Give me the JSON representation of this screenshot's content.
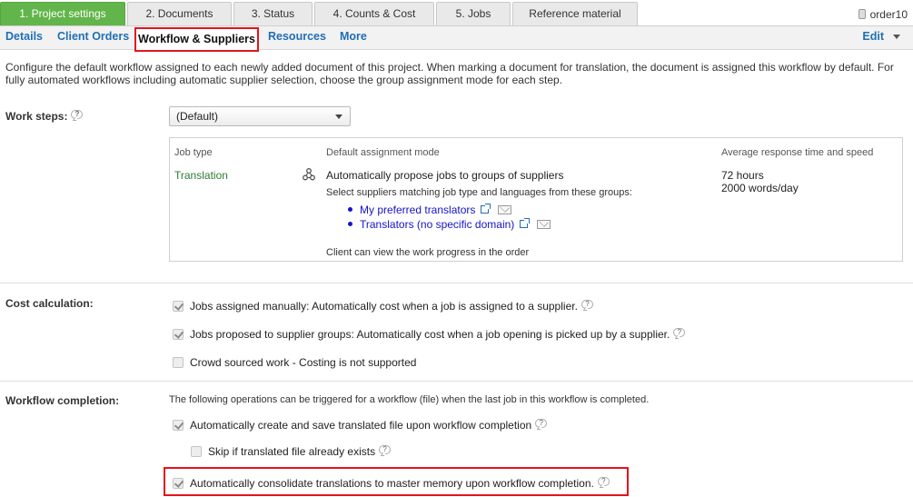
{
  "steps": [
    "1. Project settings",
    "2. Documents",
    "3. Status",
    "4. Counts & Cost",
    "5. Jobs",
    "Reference material"
  ],
  "order_label": "order10",
  "subnav": {
    "details": "Details",
    "client_orders": "Client Orders",
    "workflow": "Workflow & Suppliers",
    "resources": "Resources",
    "more": "More",
    "edit": "Edit"
  },
  "intro": "Configure the default workflow assigned to each newly added document of this project. When marking a document for translation, the document is assigned this workflow by default. For fully automated workflows including automatic supplier selection, choose the group assignment mode for each step.",
  "work_steps": {
    "label": "Work steps:",
    "help": "?",
    "selected": "(Default)",
    "table": {
      "headers": [
        "Job type",
        "Default assignment mode",
        "Average response time and speed"
      ],
      "job_type": "Translation",
      "mode": "Automatically propose jobs to groups of suppliers",
      "sub": "Select suppliers matching job type and languages from these groups:",
      "groups": [
        "My preferred translators",
        "Translators (no specific domain)"
      ],
      "client_note": "Client can view the work progress in the order",
      "response_time": "72 hours",
      "speed": "2000 words/day"
    }
  },
  "cost": {
    "label": "Cost calculation:",
    "options": [
      {
        "text": "Jobs assigned manually: Automatically cost when a job is assigned to a supplier.",
        "checked": true
      },
      {
        "text": "Jobs proposed to supplier groups: Automatically cost when a job opening is picked up by a supplier.",
        "checked": true
      },
      {
        "text": "Crowd sourced work - Costing is not supported",
        "checked": false
      }
    ]
  },
  "completion": {
    "label": "Workflow completion:",
    "note": "The following operations can be triggered for a workflow (file) when the last job in this workflow is completed.",
    "options": [
      {
        "text": "Automatically create and save translated file upon workflow completion",
        "checked": true
      },
      {
        "text": "Skip if translated file already exists",
        "checked": false
      },
      {
        "text": "Automatically consolidate translations to master memory upon workflow completion.",
        "checked": true
      }
    ]
  },
  "colors": {
    "active_step": "#62b54a",
    "link": "#1f6fb4",
    "highlight": "#e3141d",
    "job_type": "#2e7d32"
  }
}
